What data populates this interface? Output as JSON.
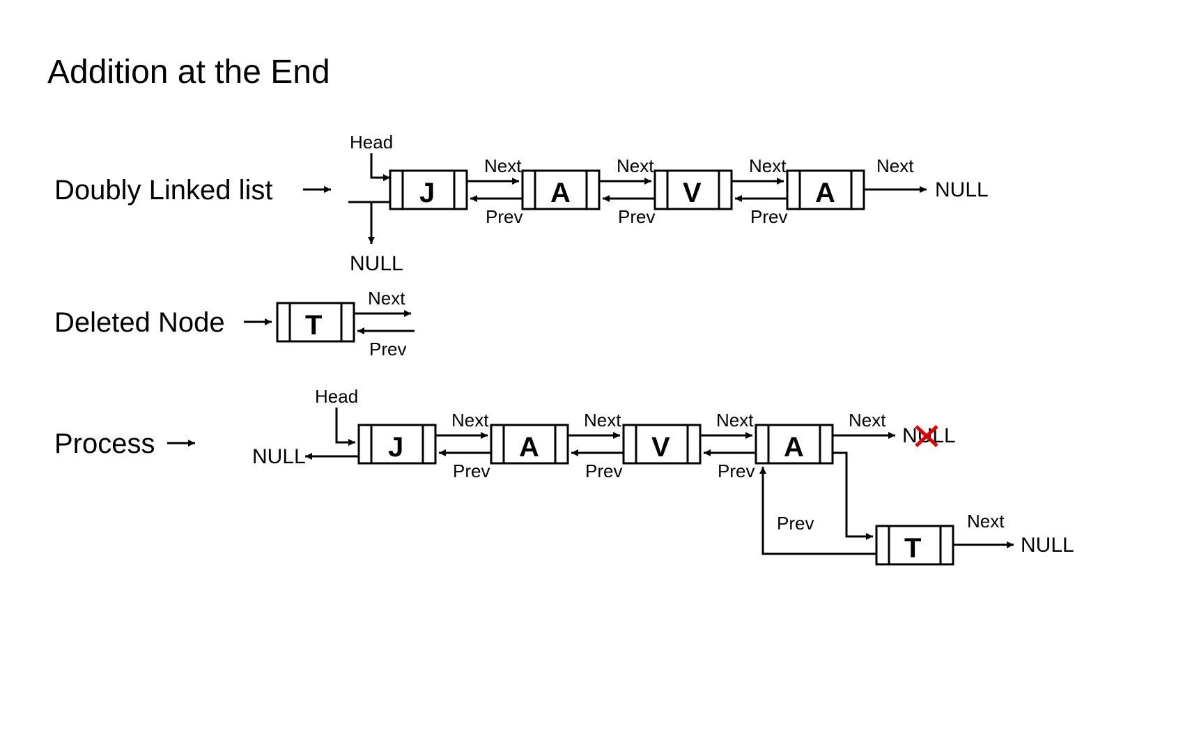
{
  "title": "Addition at the End",
  "sections": {
    "list": "Doubly Linked list",
    "deleted": "Deleted Node",
    "process": "Process"
  },
  "labels": {
    "head": "Head",
    "next": "Next",
    "prev": "Prev",
    "null": "NULL"
  },
  "nodes": {
    "row1": [
      "J",
      "A",
      "V",
      "A"
    ],
    "deleted": "T",
    "row3": [
      "J",
      "A",
      "V",
      "A"
    ],
    "newnode": "T"
  }
}
